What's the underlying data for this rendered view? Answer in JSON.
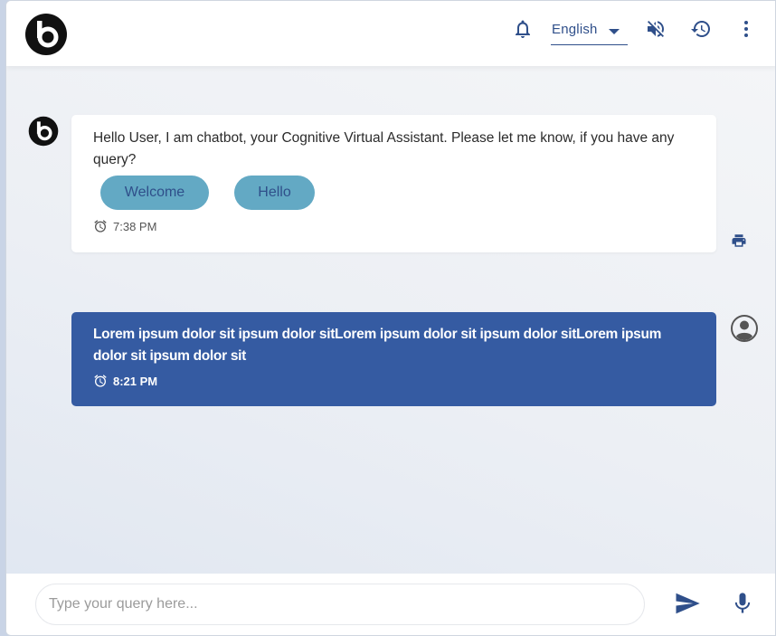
{
  "colors": {
    "primary": "#2f4f8a",
    "user_bubble": "#355ba2",
    "chip": "#63a9c4",
    "bot_bubble": "#ffffff"
  },
  "header": {
    "logo_icon": "b-logo-icon",
    "language": {
      "selected": "English",
      "icon": "caret-down-icon"
    },
    "icons": [
      "bell-icon",
      "volume-off-icon",
      "history-icon",
      "more-vert-icon"
    ]
  },
  "messages": {
    "bot": {
      "avatar_icon": "b-logo-icon",
      "text": "Hello User, I am chatbot, your Cognitive Virtual Assistant. Please let me know, if you have any query?",
      "chips": [
        "Welcome",
        "Hello"
      ],
      "time": "7:38 PM",
      "action_icon": "print-icon"
    },
    "user": {
      "avatar_icon": "account-circle-icon",
      "text": "Lorem ipsum dolor sit ipsum dolor sitLorem ipsum dolor sit ipsum dolor sitLorem ipsum dolor sit ipsum dolor sit",
      "time": "8:21 PM"
    }
  },
  "footer": {
    "placeholder": "Type your query here...",
    "value": "",
    "send_icon": "send-icon",
    "mic_icon": "mic-icon"
  }
}
